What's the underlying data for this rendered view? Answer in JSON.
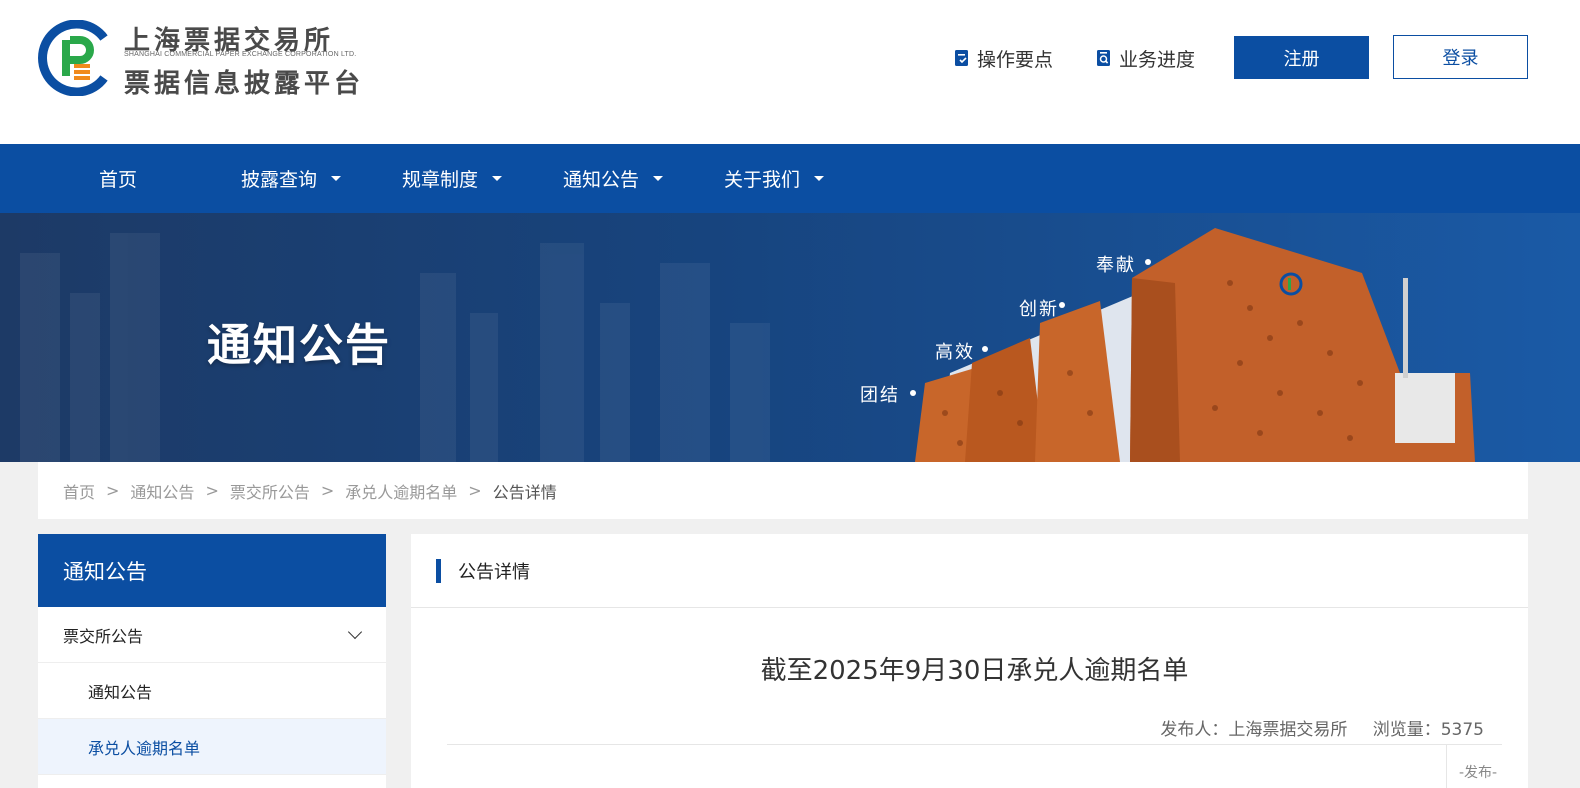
{
  "header": {
    "logo_line1": "上海票据交易所",
    "logo_sub": "SHANGHAI COMMERCIAL PAPER EXCHANGE CORPORATION LTD.",
    "logo_line2": "票据信息披露平台",
    "link_guide": "操作要点",
    "link_progress": "业务进度",
    "register_label": "注册",
    "login_label": "登录"
  },
  "nav": {
    "items": [
      {
        "label": "首页"
      },
      {
        "label": "披露查询"
      },
      {
        "label": "规章制度"
      },
      {
        "label": "通知公告"
      },
      {
        "label": "关于我们"
      }
    ]
  },
  "banner": {
    "title": "通知公告",
    "slogans": [
      "团结",
      "高效",
      "创新",
      "奉献"
    ]
  },
  "breadcrumb": {
    "items": [
      "首页",
      "通知公告",
      "票交所公告",
      "承兑人逾期名单",
      "公告详情"
    ],
    "separator": ">"
  },
  "sidebar": {
    "title": "通知公告",
    "items": [
      {
        "label": "票交所公告"
      },
      {
        "label": "通知公告"
      },
      {
        "label": "承兑人逾期名单"
      }
    ]
  },
  "main": {
    "section_title": "公告详情",
    "article_title": "截至2025年9月30日承兑人逾期名单",
    "publisher": "发布人：上海票据交易所",
    "views": "浏览量：5375",
    "publish_tag": "-发布-"
  },
  "colors": {
    "brand_blue": "#0b4ea2",
    "logo_green": "#2aa84a",
    "logo_orange": "#f08a1c",
    "building_orange": "#c8662a"
  }
}
